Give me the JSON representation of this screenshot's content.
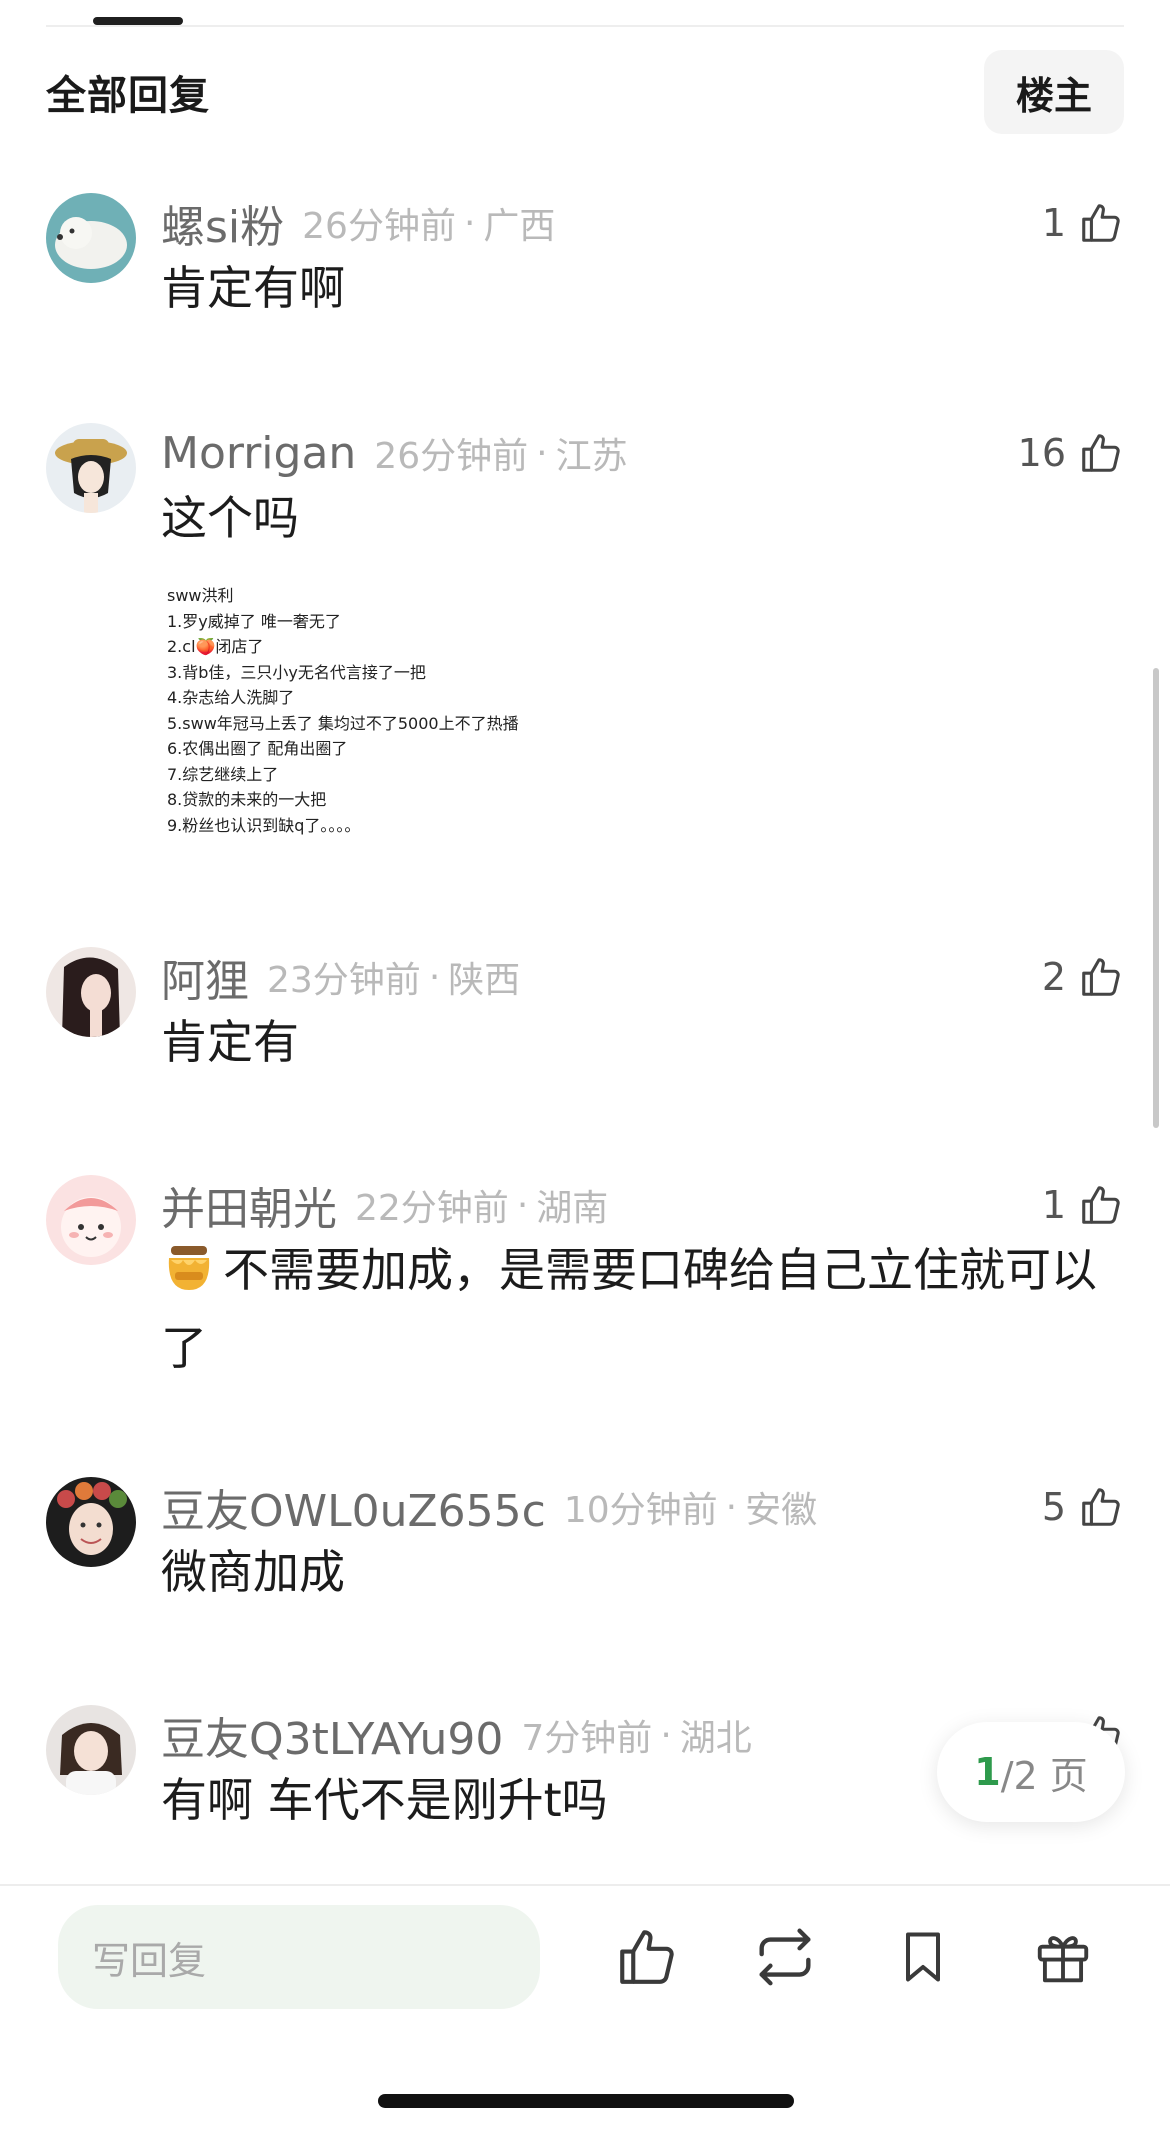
{
  "header": {
    "title": "全部回复",
    "op_label": "楼主"
  },
  "comments": [
    {
      "username": "螺si粉",
      "time": "26分钟前",
      "location": "广西",
      "likes": "1",
      "text": "肯定有啊"
    },
    {
      "username": "Morrigan",
      "time": "26分钟前",
      "location": "江苏",
      "likes": "16",
      "text": "这个吗",
      "image_lines": [
        "sww洪利",
        "1.罗y威掉了  唯一奢无了",
        "2.cl🍑闭店了",
        "3.背b佳，三只小y无名代言接了一把",
        "4.杂志给人洗脚了",
        "5.sww年冠马上丢了   集均过不了5000上不了热播",
        "6.农偶出圈了  配角出圈了",
        "7.综艺继续上了",
        "8.贷款的未来的一大把",
        "9.粉丝也认识到缺q了。。。。"
      ]
    },
    {
      "username": "阿狸",
      "time": "23分钟前",
      "location": "陕西",
      "likes": "2",
      "text": "肯定有"
    },
    {
      "username": "并田朝光",
      "time": "22分钟前",
      "location": "湖南",
      "likes": "1",
      "text": "不需要加成，是需要口碑给自己立住就可以了"
    },
    {
      "username": "豆友OWL0uZ655c",
      "time": "10分钟前",
      "location": "安徽",
      "likes": "5",
      "text": "微商加成"
    },
    {
      "username": "豆友Q3tLYAYu90",
      "time": "7分钟前",
      "location": "湖北",
      "likes": "",
      "text": "有啊 车代不是刚升t吗"
    }
  ],
  "separator": "·",
  "pager": {
    "current": "1",
    "rest": "/2 页"
  },
  "bottom_bar": {
    "reply_placeholder": "写回复",
    "icons": [
      "thumbs-up-icon",
      "repost-icon",
      "bookmark-icon",
      "gift-icon"
    ]
  },
  "colors": {
    "accent_green": "#2e9a4c",
    "reply_bg": "#eff5ef"
  }
}
